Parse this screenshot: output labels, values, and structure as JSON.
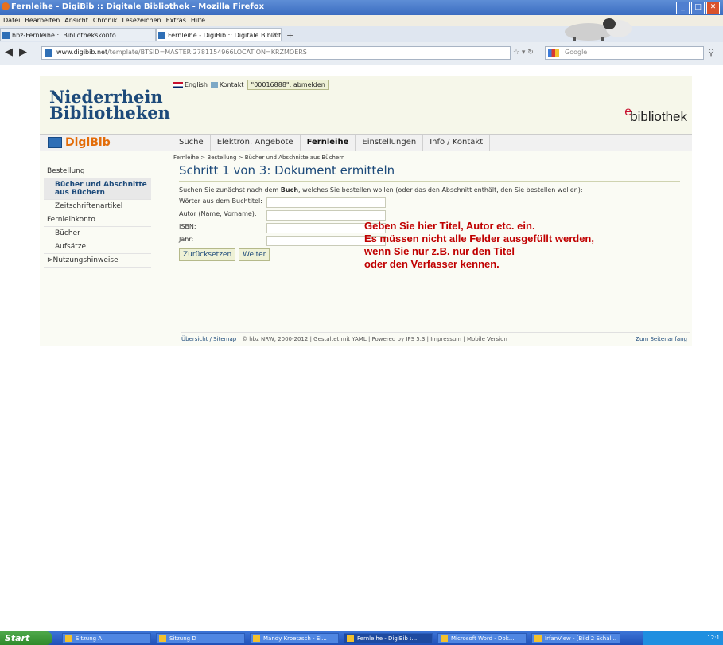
{
  "window": {
    "title": "Fernleihe - DigiBib :: Digitale Bibliothek - Mozilla Firefox",
    "buttons": [
      "_",
      "□",
      "✕"
    ]
  },
  "menu": [
    "Datei",
    "Bearbeiten",
    "Ansicht",
    "Chronik",
    "Lesezeichen",
    "Extras",
    "Hilfe"
  ],
  "tabs": [
    {
      "label": "hbz-Fernleihe :: Bibliothekskonto",
      "active": false
    },
    {
      "label": "Fernleihe - DigiBib :: Digitale Bibliothek",
      "active": true
    }
  ],
  "url": {
    "host": "www.digibib.net",
    "path": "/template/BTSID=MASTER:2781154966LOCATION=KRZMOERS"
  },
  "search": {
    "placeholder": "Google"
  },
  "header": {
    "logo_line1": "Niederrhein",
    "logo_line2": "Bibliotheken",
    "english": "English",
    "contact": "Kontakt",
    "logout": "\"00016888\": abmelden",
    "ebib_e": "e",
    "ebib_rest": "bibliothek"
  },
  "brand": "DigiBib",
  "nav": [
    "Suche",
    "Elektron. Angebote",
    "Fernleihe",
    "Einstellungen",
    "Info / Kontakt"
  ],
  "nav_active": "Fernleihe",
  "breadcrumb": "Fernleihe > Bestellung > Bücher und Abschnitte aus Büchern",
  "sidebar": [
    {
      "label": "Bestellung",
      "level": 0,
      "active": false
    },
    {
      "label": "Bücher und Abschnitte aus Büchern",
      "level": 1,
      "active": true
    },
    {
      "label": "Zeitschriftenartikel",
      "level": 1,
      "active": false
    },
    {
      "label": "Fernleihkonto",
      "level": 0,
      "active": false
    },
    {
      "label": "Bücher",
      "level": 1,
      "active": false
    },
    {
      "label": "Aufsätze",
      "level": 1,
      "active": false
    },
    {
      "label": "Nutzungshinweise",
      "level": 0,
      "active": false
    }
  ],
  "content": {
    "heading": "Schritt 1 von 3: Dokument ermitteln",
    "intro_a": "Suchen Sie zunächst nach dem ",
    "intro_b": "Buch",
    "intro_c": ", welches Sie bestellen wollen (oder das den Abschnitt enthält, den Sie bestellen wollen):",
    "fields": [
      {
        "label": "Wörter aus dem Buchtitel:",
        "value": ""
      },
      {
        "label": "Autor (Name, Vorname):",
        "value": ""
      },
      {
        "label": "ISBN:",
        "value": ""
      },
      {
        "label": "Jahr:",
        "value": ""
      }
    ],
    "reset": "Zurücksetzen",
    "next": "Weiter"
  },
  "annotation": [
    "Geben Sie hier Titel, Autor etc. ein.",
    "Es müssen nicht alle Felder ausgefüllt werden,",
    "wenn Sie nur z.B. nur den Titel",
    "oder den Verfasser kennen."
  ],
  "footer": {
    "sitemap": "Übersicht / Sitemap",
    "copy": " | © hbz NRW, 2000-2012 | Gestaltet mit YAML | Powered by IPS 5.3 | Impressum | Mobile Version",
    "top": "Zum Seitenanfang"
  },
  "taskbar": {
    "start": "Start",
    "items": [
      "Sitzung A",
      "Sitzung D",
      "Mandy Kroetzsch - Ei...",
      "Fernleihe - DigiBib :...",
      "Microsoft Word - Dok...",
      "IrfanView - [Bild 2 Schal..."
    ],
    "clock": "12:1"
  },
  "colors": {
    "accent": "#1d4a7a",
    "brand": "#e36c09",
    "annotation": "#c00000"
  }
}
